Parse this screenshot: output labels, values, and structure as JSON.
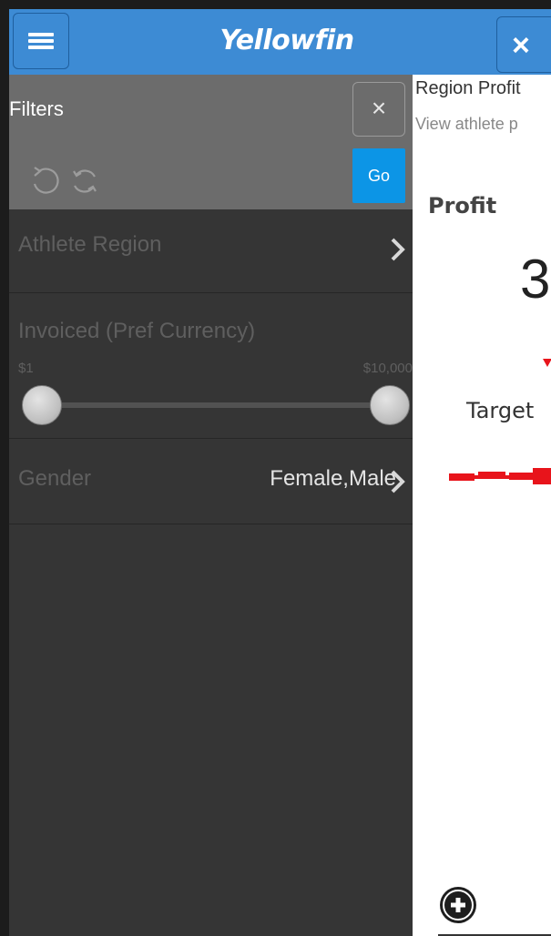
{
  "header": {
    "brand": "Yellowfin",
    "menu_icon": "hamburger-menu-icon",
    "close_icon": "close-icon",
    "close_label": "×",
    "colors": {
      "topbar": "#3d8bd4"
    }
  },
  "filters_panel": {
    "title": "Filters",
    "close_label": "×",
    "undo_icon": "undo-icon",
    "refresh_icon": "refresh-icon",
    "go_label": "Go",
    "colors": {
      "go_button": "#0c95e6",
      "panel_bg": "#353535",
      "header_bg": "#6c6c6c"
    },
    "filters": [
      {
        "label": "Athlete Region",
        "value": ""
      },
      {
        "label": "Invoiced (Pref Currency)",
        "range_min": "$1",
        "range_max": "$10,000"
      },
      {
        "label": "Gender",
        "value": "Female,Male"
      }
    ]
  },
  "report": {
    "title": "Region Profit",
    "subtitle": "View athlete p",
    "profit_label": "Profit",
    "big_number": "3",
    "target_label": "Target",
    "add_icon": "plus-circle-icon",
    "colors": {
      "trend": "#e8141b"
    }
  }
}
